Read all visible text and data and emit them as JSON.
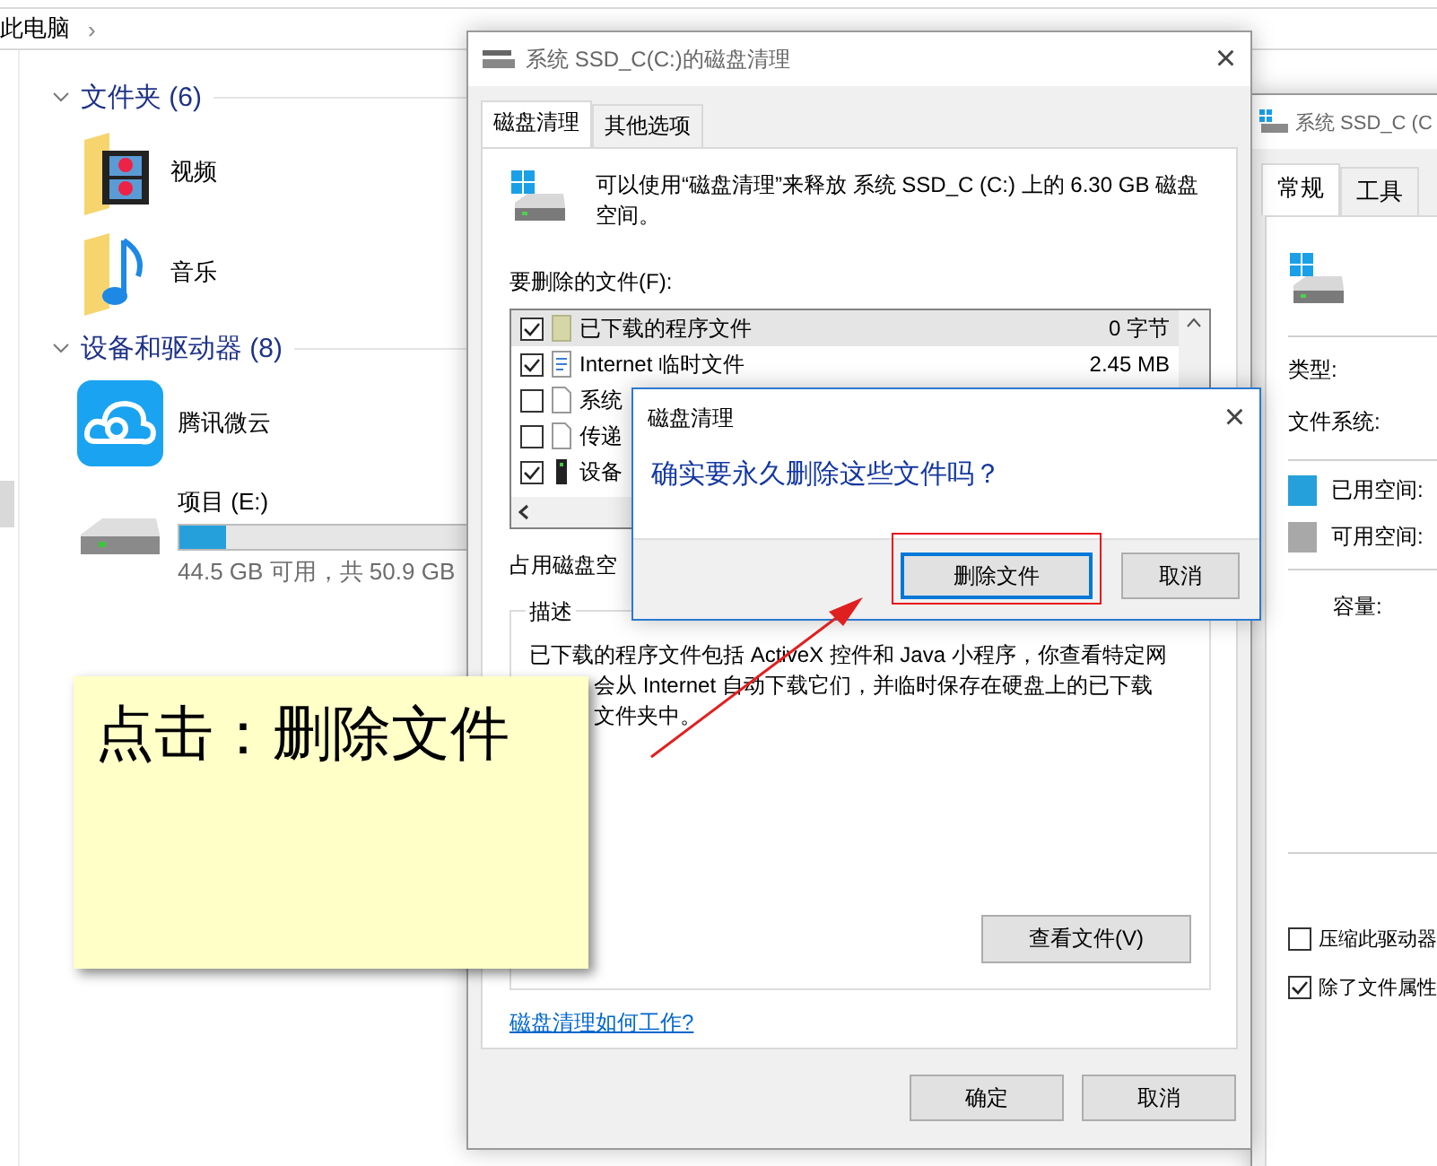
{
  "explorer": {
    "breadcrumb": "此电脑",
    "separator": "›",
    "groups": [
      {
        "title": "文件夹 (6)",
        "expanded": true,
        "items": [
          {
            "kind": "video-folder",
            "name": "视频"
          },
          {
            "kind": "music-folder",
            "name": "音乐"
          }
        ]
      },
      {
        "title": "设备和驱动器 (8)",
        "expanded": true,
        "items": [
          {
            "kind": "cloud-app",
            "name": "腾讯微云"
          },
          {
            "kind": "drive",
            "name": "项目 (E:)",
            "level": 0.13,
            "free_text": "44.5 GB 可用，共 50.9 GB"
          }
        ]
      }
    ]
  },
  "properties_window": {
    "title": "系统 SSD_C (C",
    "tabs": [
      {
        "label": "常规",
        "selected": true
      },
      {
        "label": "工具",
        "selected": false
      }
    ],
    "fields": [
      "类型:",
      "文件系统:"
    ],
    "legend": [
      {
        "label": "已用空间:",
        "color": "#26a0da"
      },
      {
        "label": "可用空间:",
        "color": "#a8a8a8"
      }
    ],
    "capacity_label": "容量:",
    "options": [
      {
        "label": "压缩此驱动器",
        "checked": false
      },
      {
        "label": "除了文件属性",
        "checked": true
      }
    ]
  },
  "cleanup_window": {
    "title": "系统 SSD_C(C:)的磁盘清理",
    "close": "×",
    "tabs": [
      {
        "label": "磁盘清理",
        "selected": true
      },
      {
        "label": "其他选项",
        "selected": false
      }
    ],
    "intro": "可以使用“磁盘清理”来释放 系统 SSD_C (C:) 上的 6.30 GB 磁盘空间。",
    "files_label": "要删除的文件(F):",
    "files": [
      {
        "kind": "folder",
        "name": "已下载的程序文件",
        "size": "0 字节",
        "checked": true,
        "selected": true
      },
      {
        "kind": "web",
        "name": "Internet 临时文件",
        "size": "2.45 MB",
        "checked": true,
        "selected": false
      },
      {
        "kind": "file",
        "name": "系统",
        "checked": false,
        "selected": false
      },
      {
        "kind": "file",
        "name": "传递",
        "checked": false,
        "selected": false
      },
      {
        "kind": "device",
        "name": "设备",
        "checked": true,
        "selected": false
      }
    ],
    "space_label": "占用磁盘空",
    "description_legend": "描述",
    "description_lines": [
      "已下载的程序文件包括 ActiveX 控件和 Java 小程序，你查看特定网",
      "会从 Internet 自动下载它们，并临时保存在硬盘上的已下载",
      "文件夹中。"
    ],
    "view_button": "查看文件(V)",
    "help_link": "磁盘清理如何工作?",
    "buttons": [
      "确定",
      "取消"
    ]
  },
  "confirm_dialog": {
    "title": "磁盘清理",
    "close": "×",
    "question": "确实要永久删除这些文件吗？",
    "buttons": [
      {
        "label": "删除文件",
        "default": true,
        "highlighted": true
      },
      {
        "label": "取消",
        "default": false,
        "highlighted": false
      }
    ]
  },
  "annotation": {
    "note": "点击：删除文件"
  }
}
